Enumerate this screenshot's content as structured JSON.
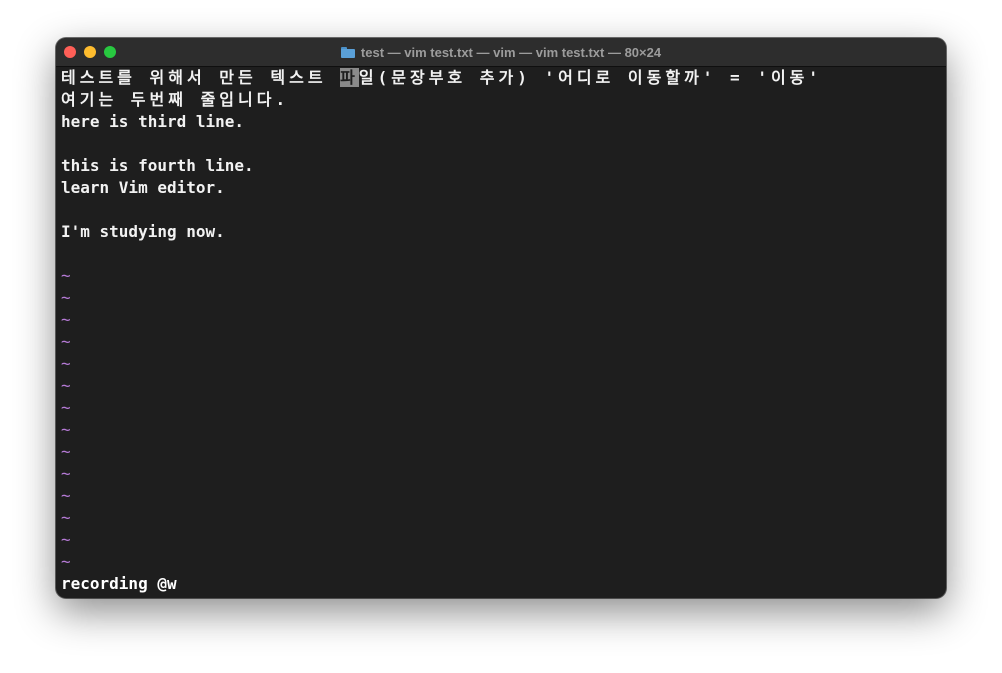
{
  "window": {
    "title": "test — vim test.txt — vim — vim test.txt — 80×24"
  },
  "buffer": {
    "line1_before": "테스트를 위해서 만든 텍스트 ",
    "line1_cursor": "파",
    "line1_after": "일(문장부호 추가) '어디로 이동할까' = '이동'",
    "line2": "여기는 두번째 줄입니다.",
    "line3": "here is third line.",
    "line4": "",
    "line5": "this is fourth line.",
    "line6": "learn Vim editor.",
    "line7": "",
    "line8": "I'm studying now.",
    "line9": "",
    "tilde": "~"
  },
  "statusline": {
    "text": "recording @w"
  },
  "colors": {
    "terminal_bg": "#1e1e1e",
    "text": "#f2f2f2",
    "tilde": "#b77bd8",
    "cursor": "#8a8a8a",
    "titlebar": "#2d2d2d"
  }
}
